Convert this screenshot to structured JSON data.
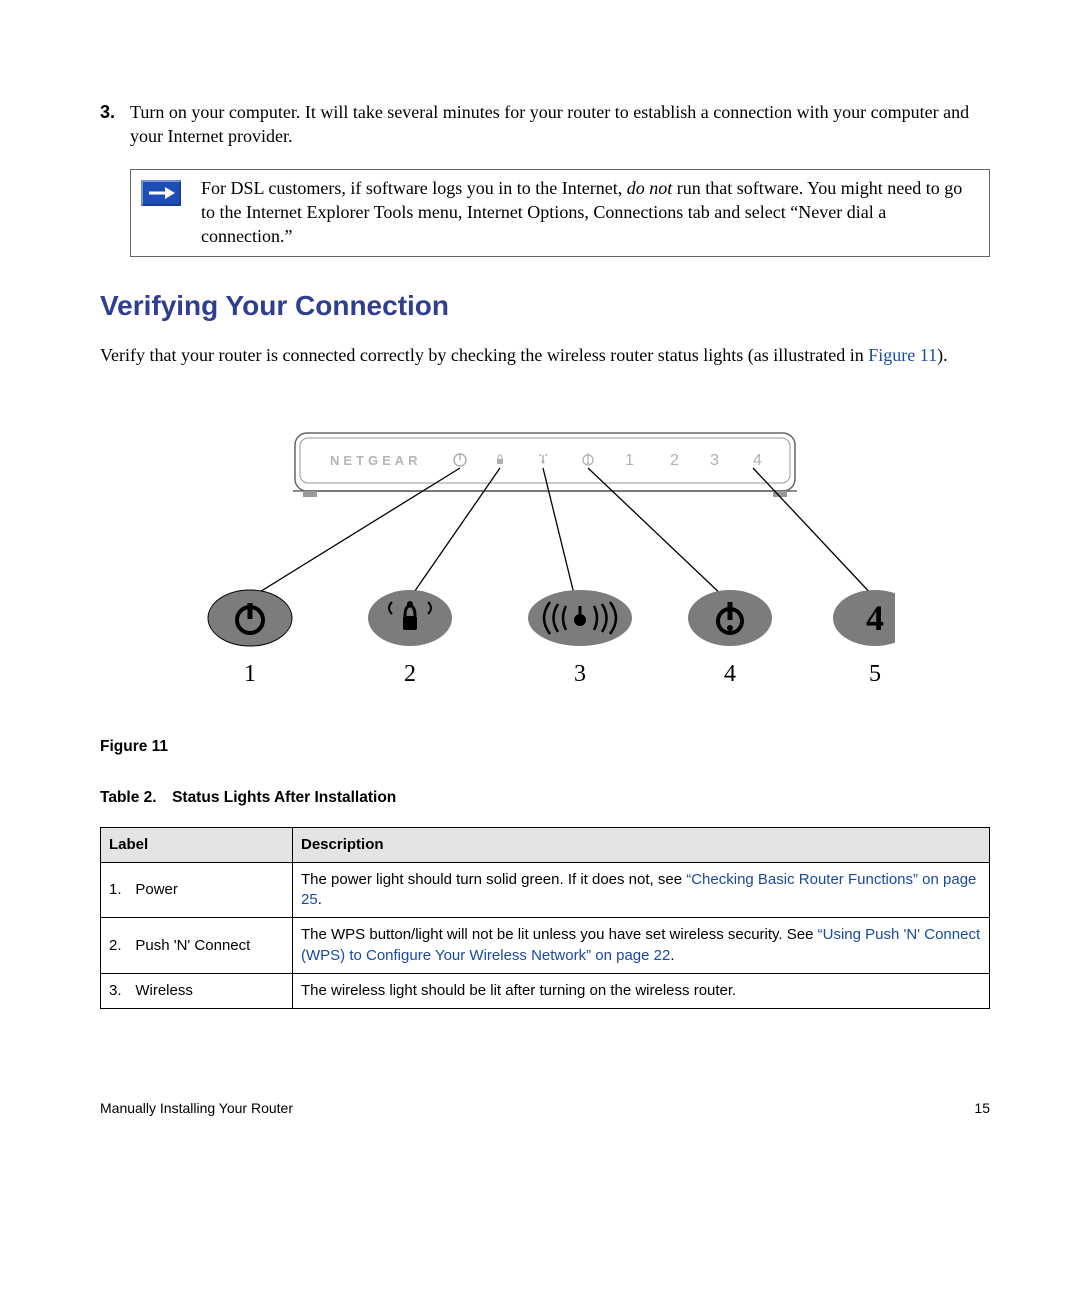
{
  "step": {
    "number": "3.",
    "text": "Turn on your computer. It will take several minutes for your router to establish a connection with your computer and your Internet provider."
  },
  "note": {
    "prefix": "For DSL customers, if software logs you in to the Internet, ",
    "emphasis": "do not",
    "suffix": " run that software. You might need to go to the Internet Explorer Tools menu, Internet Options, Connections tab and select “Never dial a connection.”"
  },
  "heading": "Verifying Your Connection",
  "intro": {
    "prefix": "Verify that your router is connected correctly by checking the wireless router status lights (as illustrated in ",
    "link": "Figure 11",
    "suffix": ")."
  },
  "router": {
    "brand": "NETGEAR",
    "panel_numbers": [
      "1",
      "2",
      "3",
      "4"
    ],
    "callouts": [
      "1",
      "2",
      "3",
      "4",
      "5"
    ],
    "big_number": "4"
  },
  "figure_label": "Figure 11",
  "table_title": "Table 2. Status Lights After Installation",
  "table": {
    "headers": {
      "label": "Label",
      "description": "Description"
    },
    "rows": [
      {
        "num": "1.",
        "name": "Power",
        "desc_prefix": "The power light should turn solid green. If it does not, see ",
        "desc_link": "“Checking Basic Router Functions” on page 25",
        "desc_suffix": "."
      },
      {
        "num": "2.",
        "name": "Push 'N' Connect",
        "desc_prefix": "The WPS button/light will not be lit unless you have set wireless security. See ",
        "desc_link": "“Using Push 'N' Connect (WPS) to Configure Your Wireless Network” on page 22",
        "desc_suffix": "."
      },
      {
        "num": "3.",
        "name": "Wireless",
        "desc_prefix": "The wireless light should be lit after turning on the wireless router.",
        "desc_link": "",
        "desc_suffix": ""
      }
    ]
  },
  "footer": {
    "left": "Manually Installing Your Router",
    "right": "15"
  }
}
